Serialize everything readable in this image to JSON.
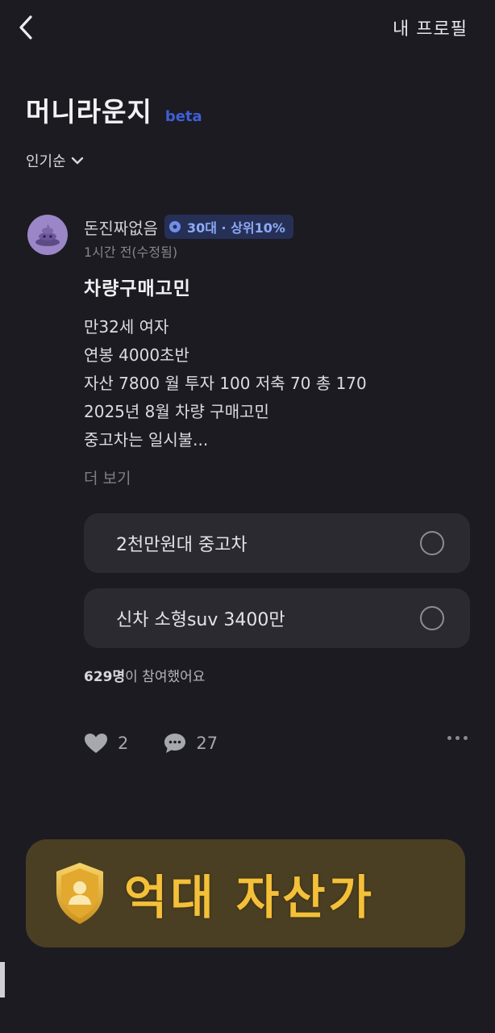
{
  "header": {
    "back_icon": "chevron-left-icon",
    "my_profile_label": "내 프로필"
  },
  "page": {
    "title": "머니라운지",
    "badge": "beta",
    "sort_label": "인기순"
  },
  "post": {
    "author": "돈진짜없음",
    "tier_badge": "30대 · 상위10%",
    "time": "1시간 전(수정됨)",
    "title": "차량구매고민",
    "body_lines": [
      "만32세 여자",
      "연봉 4000초반",
      "자산 7800 월 투자 100 저축 70 총 170",
      "2025년 8월 차량 구매고민",
      "중고차는 일시불..."
    ],
    "more_label": "더 보기",
    "poll_options": [
      {
        "label": "2천만원대 중고차"
      },
      {
        "label": "신차 소형suv 3400만"
      }
    ],
    "participants_count": "629명",
    "participants_suffix": "이 참여했어요",
    "likes": "2",
    "comments": "27"
  },
  "banner": {
    "text": "억대 자산가",
    "icon": "shield-person-icon"
  },
  "colors": {
    "background": "#1c1b22",
    "card": "#2b2a31",
    "accent_blue": "#3f5fd8",
    "banner_gold": "#f4c03a"
  }
}
